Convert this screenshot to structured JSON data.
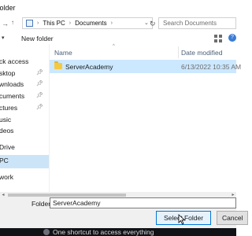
{
  "window": {
    "title": "folder"
  },
  "address_bar": {
    "crumbs": [
      "This PC",
      "Documents"
    ]
  },
  "search": {
    "placeholder": "Search Documents"
  },
  "toolbar": {
    "new_folder_label": "New folder"
  },
  "nav": {
    "items": [
      {
        "label": "ck access",
        "pinned": false,
        "selected": false
      },
      {
        "label": "sktop",
        "pinned": true,
        "selected": false
      },
      {
        "label": "wnloads",
        "pinned": true,
        "selected": false
      },
      {
        "label": "cuments",
        "pinned": true,
        "selected": false
      },
      {
        "label": "ctures",
        "pinned": true,
        "selected": false
      },
      {
        "label": "usic",
        "pinned": false,
        "selected": false
      },
      {
        "label": "deos",
        "pinned": false,
        "selected": false
      },
      {
        "label": "Drive",
        "pinned": false,
        "selected": false
      },
      {
        "label": "PC",
        "pinned": false,
        "selected": true
      },
      {
        "label": "work",
        "pinned": false,
        "selected": false
      }
    ]
  },
  "file_list": {
    "columns": {
      "name": "Name",
      "date": "Date modified"
    },
    "rows": [
      {
        "name": "ServerAcademy",
        "date": "6/13/2022 10:35 AM",
        "selected": true,
        "icon": "folder-icon"
      }
    ]
  },
  "bottom": {
    "folder_label": "Folder:",
    "folder_value": "ServerAcademy",
    "select_label": "Select Folder",
    "cancel_label": "Cancel"
  },
  "taskbar": {
    "notification_text": "One shortcut to access everything"
  },
  "colors": {
    "selection": "#cce8ff",
    "nav_selected": "#cce4f7",
    "primary_button_border": "#0078d7",
    "folder_yellow": "#f5c842",
    "taskbar": "#111216"
  }
}
